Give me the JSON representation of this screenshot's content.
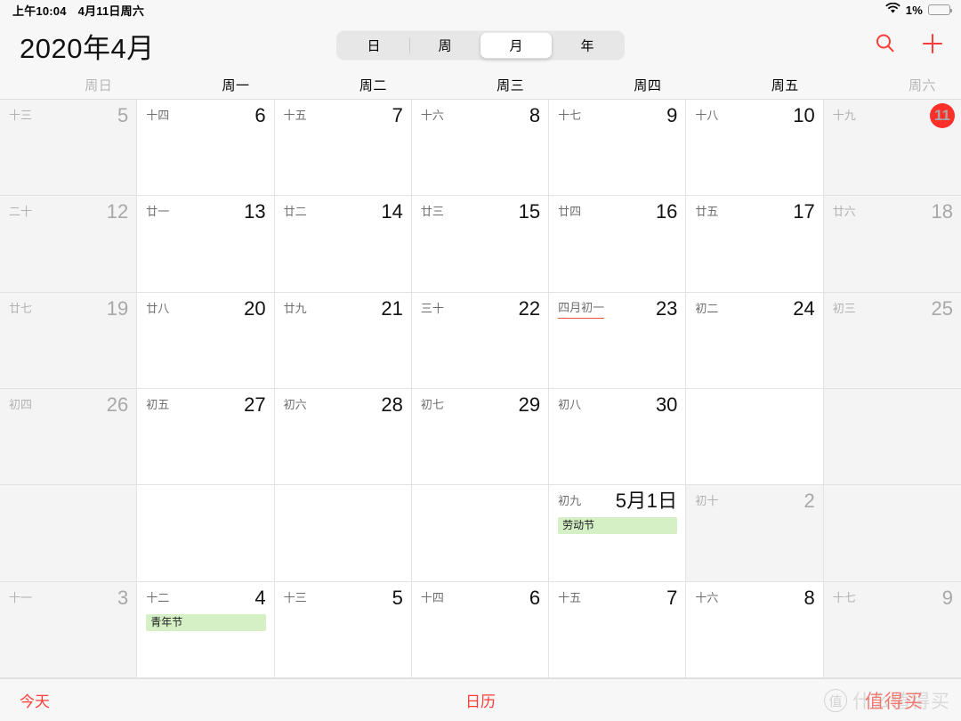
{
  "statusbar": {
    "time": "上午10:04",
    "date": "4月11日周六",
    "wifi_icon": "wifi-icon",
    "battery_percent": "1%",
    "battery_level": 1,
    "battery_color": "#f03c2e"
  },
  "navbar": {
    "title": "2020年4月",
    "segments": [
      {
        "label": "日",
        "active": false
      },
      {
        "label": "周",
        "active": false
      },
      {
        "label": "月",
        "active": true
      },
      {
        "label": "年",
        "active": false
      }
    ],
    "search_icon": "search-icon",
    "add_icon": "plus-icon",
    "accent_color": "#fc3d39"
  },
  "weekdays": [
    {
      "label": "周日",
      "dim": true
    },
    {
      "label": "周一",
      "dim": false
    },
    {
      "label": "周二",
      "dim": false
    },
    {
      "label": "周三",
      "dim": false
    },
    {
      "label": "周四",
      "dim": false
    },
    {
      "label": "周五",
      "dim": false
    },
    {
      "label": "周六",
      "dim": true
    }
  ],
  "weeks": [
    [
      {
        "lunar": "十三",
        "day": "5",
        "weekend": true,
        "today": false,
        "marked": false,
        "events": []
      },
      {
        "lunar": "十四",
        "day": "6",
        "weekend": false,
        "today": false,
        "marked": false,
        "events": []
      },
      {
        "lunar": "十五",
        "day": "7",
        "weekend": false,
        "today": false,
        "marked": false,
        "events": []
      },
      {
        "lunar": "十六",
        "day": "8",
        "weekend": false,
        "today": false,
        "marked": false,
        "events": []
      },
      {
        "lunar": "十七",
        "day": "9",
        "weekend": false,
        "today": false,
        "marked": false,
        "events": []
      },
      {
        "lunar": "十八",
        "day": "10",
        "weekend": false,
        "today": false,
        "marked": false,
        "events": []
      },
      {
        "lunar": "十九",
        "day": "11",
        "weekend": true,
        "today": true,
        "marked": false,
        "events": []
      }
    ],
    [
      {
        "lunar": "二十",
        "day": "12",
        "weekend": true,
        "today": false,
        "marked": false,
        "events": []
      },
      {
        "lunar": "廿一",
        "day": "13",
        "weekend": false,
        "today": false,
        "marked": false,
        "events": []
      },
      {
        "lunar": "廿二",
        "day": "14",
        "weekend": false,
        "today": false,
        "marked": false,
        "events": []
      },
      {
        "lunar": "廿三",
        "day": "15",
        "weekend": false,
        "today": false,
        "marked": false,
        "events": []
      },
      {
        "lunar": "廿四",
        "day": "16",
        "weekend": false,
        "today": false,
        "marked": false,
        "events": []
      },
      {
        "lunar": "廿五",
        "day": "17",
        "weekend": false,
        "today": false,
        "marked": false,
        "events": []
      },
      {
        "lunar": "廿六",
        "day": "18",
        "weekend": true,
        "today": false,
        "marked": false,
        "events": []
      }
    ],
    [
      {
        "lunar": "廿七",
        "day": "19",
        "weekend": true,
        "today": false,
        "marked": false,
        "events": []
      },
      {
        "lunar": "廿八",
        "day": "20",
        "weekend": false,
        "today": false,
        "marked": false,
        "events": []
      },
      {
        "lunar": "廿九",
        "day": "21",
        "weekend": false,
        "today": false,
        "marked": false,
        "events": []
      },
      {
        "lunar": "三十",
        "day": "22",
        "weekend": false,
        "today": false,
        "marked": false,
        "events": []
      },
      {
        "lunar": "四月初一",
        "day": "23",
        "weekend": false,
        "today": false,
        "marked": true,
        "events": []
      },
      {
        "lunar": "初二",
        "day": "24",
        "weekend": false,
        "today": false,
        "marked": false,
        "events": []
      },
      {
        "lunar": "初三",
        "day": "25",
        "weekend": true,
        "today": false,
        "marked": false,
        "events": []
      }
    ],
    [
      {
        "lunar": "初四",
        "day": "26",
        "weekend": true,
        "today": false,
        "marked": false,
        "events": []
      },
      {
        "lunar": "初五",
        "day": "27",
        "weekend": false,
        "today": false,
        "marked": false,
        "events": []
      },
      {
        "lunar": "初六",
        "day": "28",
        "weekend": false,
        "today": false,
        "marked": false,
        "events": []
      },
      {
        "lunar": "初七",
        "day": "29",
        "weekend": false,
        "today": false,
        "marked": false,
        "events": []
      },
      {
        "lunar": "初八",
        "day": "30",
        "weekend": false,
        "today": false,
        "marked": false,
        "events": []
      },
      {
        "lunar": "",
        "day": "",
        "weekend": false,
        "today": false,
        "marked": false,
        "events": []
      },
      {
        "lunar": "",
        "day": "",
        "weekend": true,
        "today": false,
        "marked": false,
        "events": []
      }
    ],
    [
      {
        "lunar": "",
        "day": "",
        "weekend": true,
        "today": false,
        "marked": false,
        "events": []
      },
      {
        "lunar": "",
        "day": "",
        "weekend": false,
        "today": false,
        "marked": false,
        "events": []
      },
      {
        "lunar": "",
        "day": "",
        "weekend": false,
        "today": false,
        "marked": false,
        "events": []
      },
      {
        "lunar": "",
        "day": "",
        "weekend": false,
        "today": false,
        "marked": false,
        "events": []
      },
      {
        "lunar": "初九",
        "day": "5月1日",
        "month_label": true,
        "weekend": false,
        "today": false,
        "marked": false,
        "events": [
          {
            "title": "劳动节",
            "color": "#d4f0c4"
          }
        ]
      },
      {
        "lunar": "初十",
        "day": "2",
        "weekend": true,
        "today": false,
        "marked": false,
        "events": []
      },
      {
        "lunar": "",
        "day": "",
        "weekend": true,
        "today": false,
        "marked": false,
        "events": []
      }
    ],
    [
      {
        "lunar": "十一",
        "day": "3",
        "weekend": true,
        "today": false,
        "marked": false,
        "events": []
      },
      {
        "lunar": "十二",
        "day": "4",
        "weekend": false,
        "today": false,
        "marked": false,
        "events": [
          {
            "title": "青年节",
            "color": "#d4f0c4"
          }
        ]
      },
      {
        "lunar": "十三",
        "day": "5",
        "weekend": false,
        "today": false,
        "marked": false,
        "events": []
      },
      {
        "lunar": "十四",
        "day": "6",
        "weekend": false,
        "today": false,
        "marked": false,
        "events": []
      },
      {
        "lunar": "十五",
        "day": "7",
        "weekend": false,
        "today": false,
        "marked": false,
        "events": []
      },
      {
        "lunar": "十六",
        "day": "8",
        "weekend": false,
        "today": false,
        "marked": false,
        "events": []
      },
      {
        "lunar": "十七",
        "day": "9",
        "weekend": true,
        "today": false,
        "marked": false,
        "events": []
      }
    ]
  ],
  "bottombar": {
    "today_label": "今天",
    "calendars_label": "日历"
  },
  "watermark": {
    "badge": "值",
    "text": "什么值得买",
    "overlay": "值得买"
  }
}
